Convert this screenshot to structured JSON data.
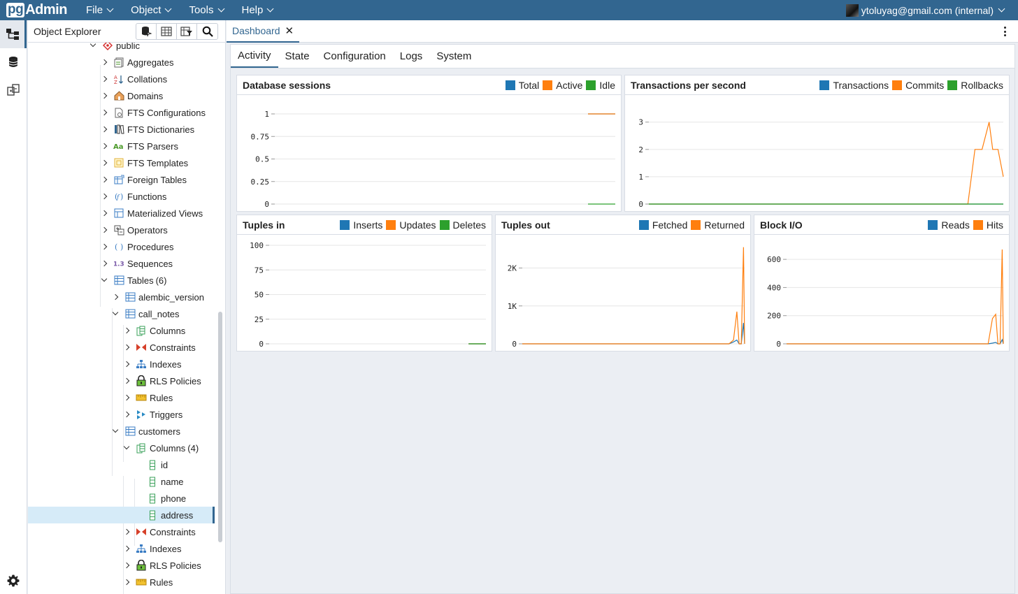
{
  "topbar": {
    "logo_pg": "pg",
    "logo_admin": "Admin",
    "menus": [
      "File",
      "Object",
      "Tools",
      "Help"
    ],
    "user": "ytoluyag@gmail.com (internal)"
  },
  "explorer": {
    "title": "Object Explorer",
    "tree": [
      {
        "label": "public",
        "level": 0,
        "state": "open",
        "icon": "schema-icon"
      },
      {
        "label": "Aggregates",
        "level": 1,
        "state": "closed",
        "icon": "aggregate-icon"
      },
      {
        "label": "Collations",
        "level": 1,
        "state": "closed",
        "icon": "collation-icon"
      },
      {
        "label": "Domains",
        "level": 1,
        "state": "closed",
        "icon": "domain-icon"
      },
      {
        "label": "FTS Configurations",
        "level": 1,
        "state": "closed",
        "icon": "fts-config-icon"
      },
      {
        "label": "FTS Dictionaries",
        "level": 1,
        "state": "closed",
        "icon": "fts-dictionary-icon"
      },
      {
        "label": "FTS Parsers",
        "level": 1,
        "state": "closed",
        "icon": "fts-parser-icon"
      },
      {
        "label": "FTS Templates",
        "level": 1,
        "state": "closed",
        "icon": "fts-template-icon"
      },
      {
        "label": "Foreign Tables",
        "level": 1,
        "state": "closed",
        "icon": "foreign-table-icon"
      },
      {
        "label": "Functions",
        "level": 1,
        "state": "closed",
        "icon": "function-icon"
      },
      {
        "label": "Materialized Views",
        "level": 1,
        "state": "closed",
        "icon": "materialized-view-icon"
      },
      {
        "label": "Operators",
        "level": 1,
        "state": "closed",
        "icon": "operator-icon"
      },
      {
        "label": "Procedures",
        "level": 1,
        "state": "closed",
        "icon": "procedure-icon"
      },
      {
        "label": "Sequences",
        "level": 1,
        "state": "closed",
        "icon": "sequence-icon"
      },
      {
        "label": "Tables",
        "count": "(6)",
        "level": 1,
        "state": "open",
        "icon": "tables-icon"
      },
      {
        "label": "alembic_version",
        "level": 2,
        "state": "closed",
        "icon": "table-icon"
      },
      {
        "label": "call_notes",
        "level": 2,
        "state": "open",
        "icon": "table-icon"
      },
      {
        "label": "Columns",
        "level": 3,
        "state": "closed",
        "icon": "columns-icon"
      },
      {
        "label": "Constraints",
        "level": 3,
        "state": "closed",
        "icon": "constraints-icon"
      },
      {
        "label": "Indexes",
        "level": 3,
        "state": "closed",
        "icon": "indexes-icon"
      },
      {
        "label": "RLS Policies",
        "level": 3,
        "state": "closed",
        "icon": "rls-policy-icon"
      },
      {
        "label": "Rules",
        "level": 3,
        "state": "closed",
        "icon": "rules-icon"
      },
      {
        "label": "Triggers",
        "level": 3,
        "state": "closed",
        "icon": "triggers-icon"
      },
      {
        "label": "customers",
        "level": 2,
        "state": "open",
        "icon": "table-icon"
      },
      {
        "label": "Columns",
        "count": "(4)",
        "level": 3,
        "state": "open",
        "icon": "columns-icon"
      },
      {
        "label": "id",
        "level": 4,
        "state": "leaf",
        "icon": "column-icon"
      },
      {
        "label": "name",
        "level": 4,
        "state": "leaf",
        "icon": "column-icon"
      },
      {
        "label": "phone",
        "level": 4,
        "state": "leaf",
        "icon": "column-icon"
      },
      {
        "label": "address",
        "level": 4,
        "state": "leaf",
        "icon": "column-icon",
        "selected": true
      },
      {
        "label": "Constraints",
        "level": 3,
        "state": "closed",
        "icon": "constraints-icon"
      },
      {
        "label": "Indexes",
        "level": 3,
        "state": "closed",
        "icon": "indexes-icon"
      },
      {
        "label": "RLS Policies",
        "level": 3,
        "state": "closed",
        "icon": "rls-policy-icon"
      },
      {
        "label": "Rules",
        "level": 3,
        "state": "closed",
        "icon": "rules-icon"
      }
    ]
  },
  "main": {
    "tab_label": "Dashboard",
    "subtabs": [
      "Activity",
      "State",
      "Configuration",
      "Logs",
      "System"
    ],
    "active_subtab": "Activity"
  },
  "colors": {
    "blue": "#1f77b4",
    "orange": "#ff7f0e",
    "green": "#2ca02c",
    "accent": "#326690"
  },
  "chart_data": [
    {
      "id": "sessions",
      "type": "line",
      "title": "Database sessions",
      "legend": [
        "Total",
        "Active",
        "Idle"
      ],
      "ylim": [
        0,
        1
      ],
      "yticks": [
        0,
        0.25,
        0.5,
        0.75,
        1
      ],
      "ytick_labels": [
        "0",
        "0.25",
        "0.5",
        "0.75",
        "1"
      ],
      "series": [
        {
          "name": "Total",
          "color": "#1f77b4",
          "values": [
            1,
            1,
            1
          ]
        },
        {
          "name": "Active",
          "color": "#ff7f0e",
          "values": [
            1,
            1,
            1
          ]
        },
        {
          "name": "Idle",
          "color": "#2ca02c",
          "values": [
            0,
            0,
            0
          ]
        }
      ]
    },
    {
      "id": "transactions",
      "type": "line",
      "title": "Transactions per second",
      "legend": [
        "Transactions",
        "Commits",
        "Rollbacks"
      ],
      "ylim": [
        0,
        3.3
      ],
      "yticks": [
        0,
        1,
        2,
        3
      ],
      "ytick_labels": [
        "0",
        "1",
        "2",
        "3"
      ],
      "series": [
        {
          "name": "Transactions",
          "color": "#1f77b4",
          "values": [
            0,
            0,
            0,
            0,
            0,
            0,
            0,
            0,
            0
          ]
        },
        {
          "name": "Commits",
          "color": "#ff7f0e",
          "values": [
            0,
            0,
            0,
            2,
            2,
            3,
            2,
            2,
            1
          ]
        },
        {
          "name": "Rollbacks",
          "color": "#2ca02c",
          "values": [
            0,
            0,
            0,
            0,
            0,
            0,
            0,
            0,
            0
          ]
        }
      ]
    },
    {
      "id": "tuples_in",
      "type": "line",
      "title": "Tuples in",
      "legend": [
        "Inserts",
        "Updates",
        "Deletes"
      ],
      "ylim": [
        0,
        100
      ],
      "yticks": [
        0,
        25,
        50,
        75,
        100
      ],
      "ytick_labels": [
        "0",
        "25",
        "50",
        "75",
        "100"
      ],
      "series": [
        {
          "name": "Inserts",
          "color": "#1f77b4",
          "values": [
            0,
            0,
            0
          ]
        },
        {
          "name": "Updates",
          "color": "#ff7f0e",
          "values": [
            0,
            0,
            0
          ]
        },
        {
          "name": "Deletes",
          "color": "#2ca02c",
          "values": [
            0,
            0,
            0
          ]
        }
      ]
    },
    {
      "id": "tuples_out",
      "type": "line",
      "title": "Tuples out",
      "legend": [
        "Fetched",
        "Returned"
      ],
      "ylim": [
        0,
        2600
      ],
      "yticks": [
        0,
        1000,
        2000
      ],
      "ytick_labels": [
        "0",
        "1K",
        "2K"
      ],
      "series": [
        {
          "name": "Fetched",
          "color": "#1f77b4",
          "values": [
            0,
            0,
            0,
            50,
            100,
            0,
            0,
            550,
            0
          ]
        },
        {
          "name": "Returned",
          "color": "#ff7f0e",
          "values": [
            0,
            0,
            0,
            100,
            850,
            0,
            0,
            2550,
            0
          ]
        }
      ]
    },
    {
      "id": "block_io",
      "type": "line",
      "title": "Block I/O",
      "legend": [
        "Reads",
        "Hits"
      ],
      "ylim": [
        0,
        700
      ],
      "yticks": [
        0,
        200,
        400,
        600
      ],
      "ytick_labels": [
        "0",
        "200",
        "400",
        "600"
      ],
      "series": [
        {
          "name": "Reads",
          "color": "#1f77b4",
          "values": [
            0,
            0,
            0,
            5,
            10,
            0,
            0,
            30,
            0
          ]
        },
        {
          "name": "Hits",
          "color": "#ff7f0e",
          "values": [
            0,
            0,
            0,
            180,
            210,
            0,
            0,
            670,
            0
          ]
        }
      ]
    }
  ]
}
